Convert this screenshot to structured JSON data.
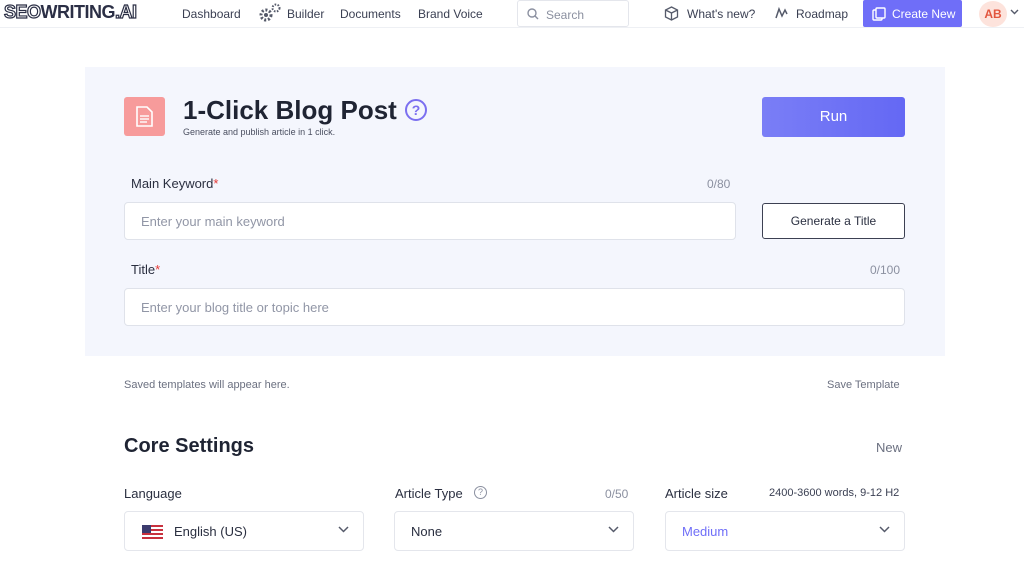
{
  "nav": {
    "logo": {
      "seo": "SEO",
      "writing": "WRITING",
      "ai": ".AI"
    },
    "links": [
      "Dashboard",
      "Builder",
      "Documents",
      "Brand Voice"
    ],
    "search_placeholder": "Search",
    "whats_new": "What's new?",
    "roadmap": "Roadmap",
    "create_new": "Create New",
    "avatar_initials": "AB"
  },
  "header": {
    "title": "1-Click Blog Post",
    "help": "?",
    "subtitle": "Generate and publish article in 1 click.",
    "run_label": "Run"
  },
  "form": {
    "keyword": {
      "label": "Main Keyword",
      "required": "*",
      "counter": "0/80",
      "placeholder": "Enter your main keyword",
      "value": ""
    },
    "generate_title": "Generate a Title",
    "title": {
      "label": "Title",
      "required": "*",
      "counter": "0/100",
      "placeholder": "Enter your blog title or topic here",
      "value": ""
    }
  },
  "templates": {
    "note": "Saved templates will appear here.",
    "save": "Save Template"
  },
  "core_settings": {
    "title": "Core Settings",
    "new_link": "New",
    "language": {
      "label": "Language",
      "value": "English (US)"
    },
    "article_type": {
      "label": "Article Type",
      "help": "?",
      "counter": "0/50",
      "value": "None"
    },
    "article_size": {
      "label": "Article size",
      "meta": "2400-3600 words, 9-12 H2",
      "value": "Medium"
    }
  },
  "colors": {
    "accent": "#6f6ef8",
    "required": "#e53935",
    "doc_icon": "#f79b9b",
    "card_bg": "#f4f6fd"
  }
}
